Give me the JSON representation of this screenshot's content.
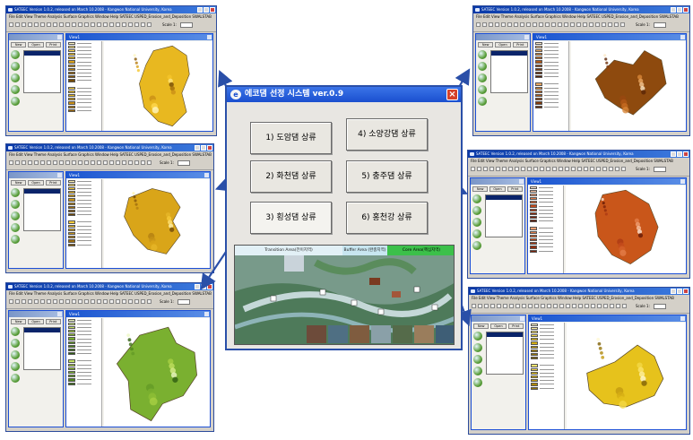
{
  "satec_windows": [
    {
      "title": "SATEEC Version 1.0.2, released on March 10.2008 - Kangwon National University, Korea",
      "menu": "File  Edit  View  Theme  Analysis  Surface  Graphics  Window  Help  SATEEC  USPED_Erosion_and_Deposition  SWALSTAB",
      "scale_label": "Scale 1:",
      "view_title": "View1",
      "map_color": "#e8b820",
      "legend_colors": [
        "#fff6c2",
        "#ffe680",
        "#ffd84d",
        "#f5c52a",
        "#e8b820",
        "#d9a21a",
        "#c98f16",
        "#b77c10",
        "#a06b0d",
        "#8a5a0a",
        "#744b08"
      ]
    },
    {
      "title": "SATEEC Version 1.0.2, released on March 10.2008 - Kangwon National University, Korea",
      "menu": "File  Edit  View  Theme  Analysis  Surface  Graphics  Window  Help  SATEEC  USPED_Erosion_and_Deposition  SWALSTAB",
      "scale_label": "Scale 1:",
      "view_title": "View1",
      "map_color": "#d9a519",
      "legend_colors": [
        "#fff2b0",
        "#ffe070",
        "#f6cb3a",
        "#e6b628",
        "#d9a519",
        "#c79216",
        "#b37f12",
        "#9d6d0f",
        "#86590b",
        "#704807"
      ]
    },
    {
      "title": "SATEEC Version 1.0.2, released on March 10.2008 - Kangwon National University, Korea",
      "menu": "File  Edit  View  Theme  Analysis  Surface  Graphics  Window  Help  SATEEC  USPED_Erosion_and_Deposition  SWALSTAB",
      "scale_label": "Scale 1:",
      "view_title": "View1",
      "map_color": "#7ab030",
      "legend_colors": [
        "#eef7c6",
        "#d9ee8c",
        "#c2e060",
        "#a8cf44",
        "#8fbf36",
        "#7ab030",
        "#649b27",
        "#50861f",
        "#3f7218",
        "#305e12"
      ]
    },
    {
      "title": "SATEEC Version 1.0.2, released on March 10.2008 - Kangwon National University, Korea",
      "menu": "File  Edit  View  Theme  Analysis  Surface  Graphics  Window  Help  SATEEC  USPED_Erosion_and_Deposition  SWALSTAB",
      "scale_label": "Scale 1:",
      "view_title": "View1",
      "map_color": "#8e4a0e",
      "legend_colors": [
        "#fde8c8",
        "#f6c893",
        "#eaa55f",
        "#d88638",
        "#c86b20",
        "#b25716",
        "#9a4710",
        "#823a0c",
        "#6d2e08",
        "#5a2406"
      ]
    },
    {
      "title": "SATEEC Version 1.0.2, released on March 10.2008 - Kangwon National University, Korea",
      "menu": "File  Edit  View  Theme  Analysis  Surface  Graphics  Window  Help  SATEEC  USPED_Erosion_and_Deposition  SWALSTAB",
      "scale_label": "Scale 1:",
      "view_title": "View1",
      "map_color": "#c9561a",
      "legend_colors": [
        "#fde5d4",
        "#f9c3a3",
        "#f09f72",
        "#e47d48",
        "#d5612a",
        "#c44b1c",
        "#ac3a14",
        "#942d0e",
        "#7c220a",
        "#641906"
      ]
    },
    {
      "title": "SATEEC Version 1.0.2, released on March 10.2008 - Kangwon National University, Korea",
      "menu": "File  Edit  View  Theme  Analysis  Surface  Graphics  Window  Help  SATEEC  USPED_Erosion_and_Deposition  SWALSTAB",
      "scale_label": "Scale 1:",
      "view_title": "View1",
      "map_color": "#e6c21c",
      "legend_colors": [
        "#fff9d6",
        "#fff0a0",
        "#fbe56e",
        "#f4d846",
        "#e6c21c",
        "#d6ae14",
        "#c39a10",
        "#ad870c",
        "#96740a",
        "#7f6208"
      ]
    }
  ],
  "nav_buttons": [
    "New",
    "Open",
    "Print"
  ],
  "center": {
    "title": "에코댐 선정 시스템 ver.0.9",
    "buttons": [
      "1) 도암댐 상류",
      "2) 화천댐 상류",
      "3) 횡성댐 상류",
      "4) 소양강댐 상류",
      "5) 충주댐 상류",
      "6) 홍천강 상류"
    ],
    "zones": [
      "Transition Area(전이지역)",
      "Buffer Area (완충지역)",
      "Core Area(핵심지역)"
    ]
  },
  "colors": {
    "frame": "#2d4c9c",
    "arrow": "#2a4fa8",
    "title_bar": "#1a4fcf"
  }
}
